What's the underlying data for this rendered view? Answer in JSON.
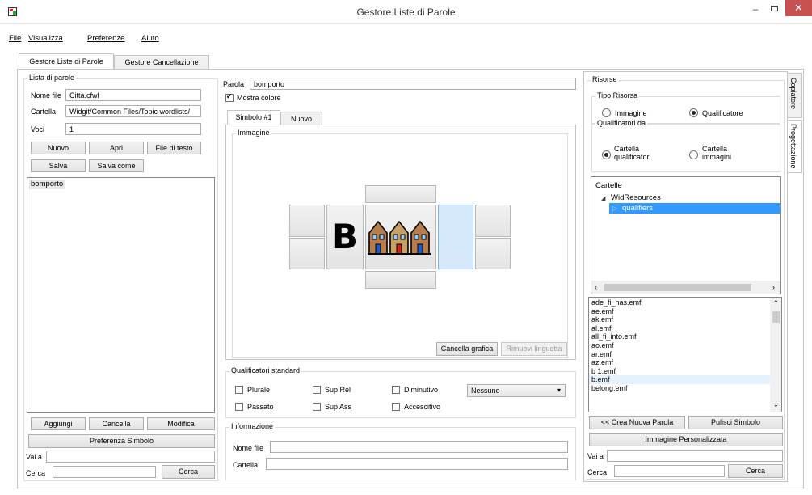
{
  "window": {
    "title": "Gestore Liste di Parole"
  },
  "menu": {
    "file": "File",
    "view": "Visualizza",
    "prefs": "Preferenze",
    "help": "Aiuto"
  },
  "tabs": {
    "main": "Gestore Liste di Parole",
    "deletion": "Gestore Cancellazione"
  },
  "wordlist": {
    "group_label": "Lista di parole",
    "filename_label": "Nome file",
    "filename_value": "Città.cfwl",
    "folder_label": "Cartella",
    "folder_value": "Widgit/Common Files/Topic wordlists/",
    "entries_label": "Voci",
    "entries_value": "1",
    "new_btn": "Nuovo",
    "open_btn": "Apri",
    "textfile_btn": "File di testo",
    "save_btn": "Salva",
    "saveas_btn": "Salva come",
    "items": [
      "bomporto"
    ],
    "add_btn": "Aggiungi",
    "delete_btn": "Cancella",
    "edit_btn": "Modifica",
    "symbol_pref_btn": "Preferenza Simbolo",
    "goto_label": "Vai a",
    "search_label": "Cerca",
    "search_btn": "Cerca"
  },
  "editor": {
    "word_label": "Parola",
    "word_value": "bomporto",
    "show_color_label": "Mostra colore",
    "symbol_tab": "Simbolo #1",
    "new_tab": "Nuovo",
    "image_group": "Immagine",
    "clear_graphic_btn": "Cancella grafica",
    "remove_tab_btn": "Rimuovi linguetta",
    "symbol_letter": "B",
    "qualifiers": {
      "group_label": "Qualificatori standard",
      "plural": "Plurale",
      "sup_rel": "Sup Rel",
      "diminutive": "Diminutivo",
      "past": "Passato",
      "sup_abs": "Sup Ass",
      "augmentative": "Accescitivo",
      "dropdown_value": "Nessuno"
    },
    "info": {
      "group_label": "Informazione",
      "filename_label": "Nome file",
      "folder_label": "Cartella"
    }
  },
  "resources": {
    "group_label": "Risorse",
    "type_group": "Tipo Risorsa",
    "image_option": "Immagine",
    "qualifier_option": "Qualificatore",
    "qual_from_group": "Qualificatori da",
    "qual_folder_option": "Cartella qualificatori",
    "image_folder_option": "Cartella immagini",
    "folders_header": "Cartelle",
    "tree_root": "WidResources",
    "tree_child": "qualifiers",
    "files": [
      "ade_fi_has.emf",
      "ae.emf",
      "ak.emf",
      "al.emf",
      "all_fi_into.emf",
      "ao.emf",
      "ar.emf",
      "az.emf",
      "b 1.emf",
      "b.emf",
      "belong.emf"
    ],
    "create_word_btn": "<< Crea Nuova Parola",
    "clear_symbol_btn": "Pulisci Simbolo",
    "custom_image_btn": "Immagine Personalizzata",
    "goto_label": "Vai a",
    "search_label": "Cerca",
    "search_btn": "Cerca"
  },
  "side_tabs": {
    "copy": "Copiatore",
    "design": "Progettazione"
  },
  "colors": {
    "accent": "#3399ff",
    "selection": "#3399ff",
    "close": "#c75050"
  }
}
